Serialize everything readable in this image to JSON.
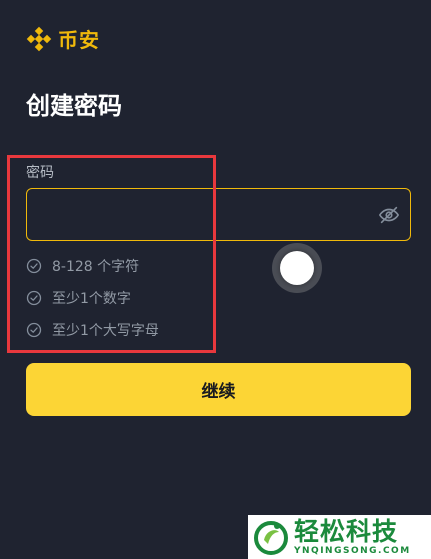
{
  "header": {
    "logo_icon": "binance-diamond-icon",
    "logo_text": "币安",
    "brand_color": "#f0b90b"
  },
  "page": {
    "title": "创建密码"
  },
  "password": {
    "label": "密码",
    "value": "",
    "visibility_icon": "eye-off-icon"
  },
  "rules": [
    {
      "icon": "check-circle-icon",
      "text": "8-128 个字符"
    },
    {
      "icon": "check-circle-icon",
      "text": "至少1个数字"
    },
    {
      "icon": "check-circle-icon",
      "text": "至少1个大写字母"
    }
  ],
  "actions": {
    "continue_label": "继续",
    "button_color": "#fcd535"
  },
  "watermark": {
    "main": "轻松科技",
    "sub": "YNQINGSONG.COM"
  }
}
